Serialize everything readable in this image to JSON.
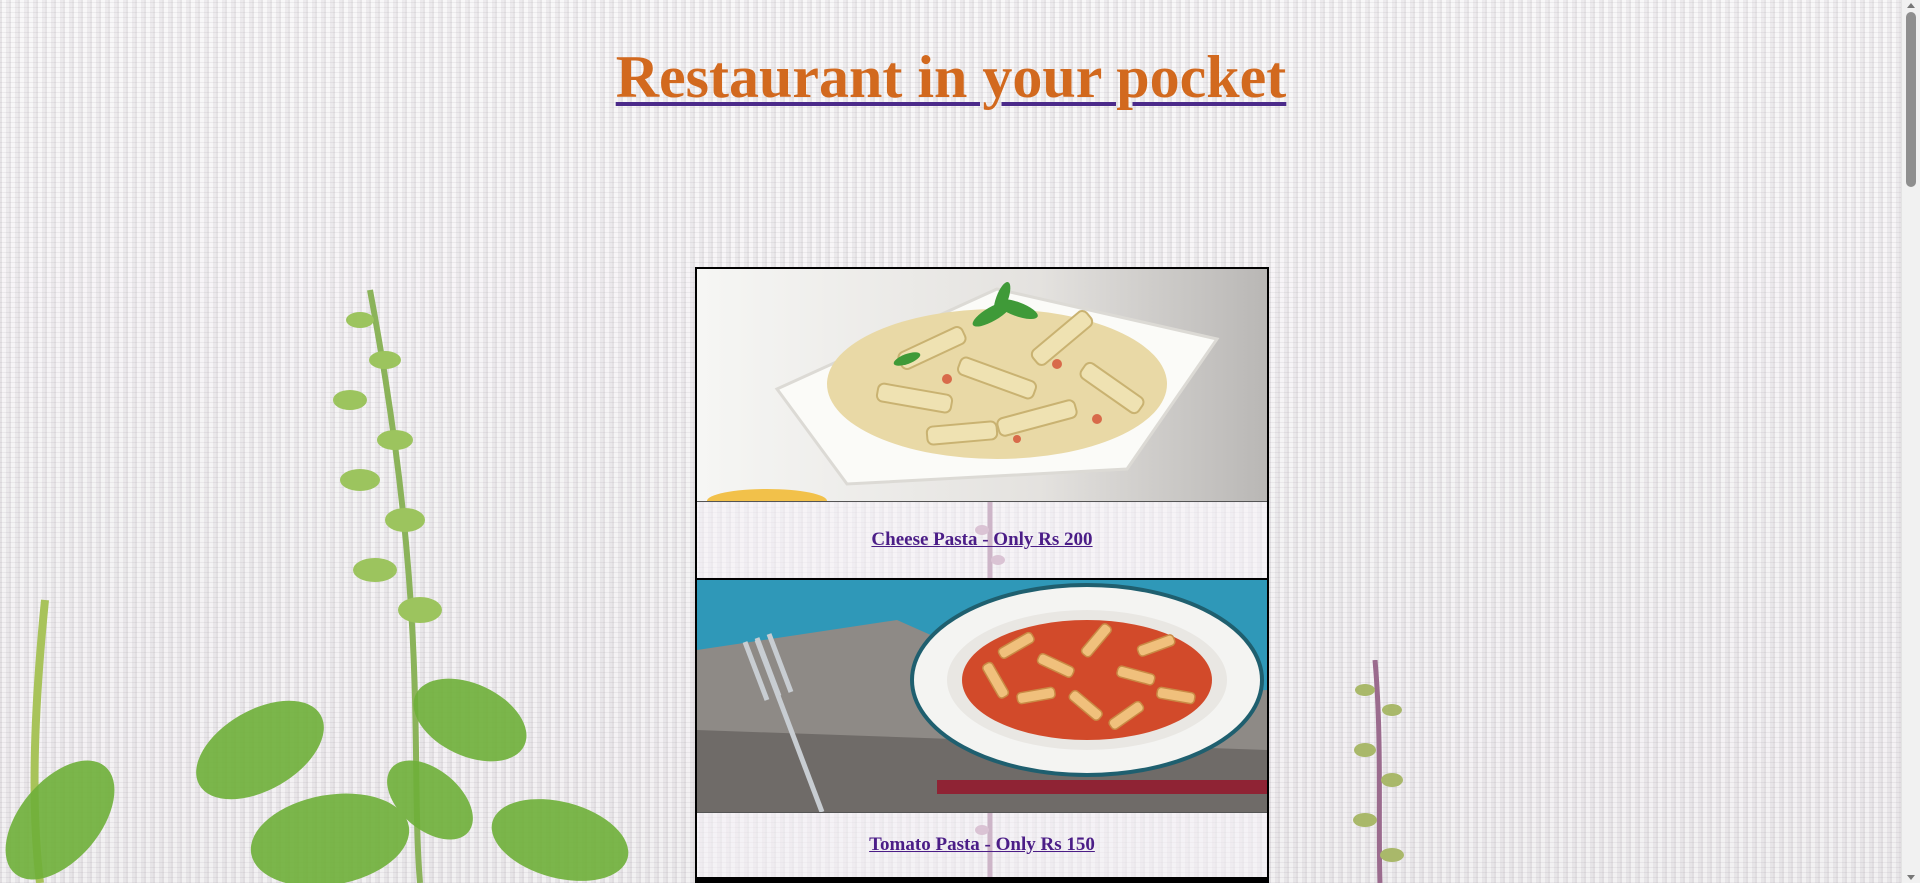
{
  "header": {
    "title": "Restaurant in your pocket"
  },
  "menu": {
    "items": [
      {
        "label": "Cheese Pasta - Only Rs 200",
        "photo": "cheese-pasta-photo"
      },
      {
        "label": "Tomato Pasta - Only Rs 150",
        "photo": "tomato-pasta-photo"
      }
    ]
  },
  "colors": {
    "title": "#d2691e",
    "link": "#4b1d87",
    "background": "#f1eeef"
  }
}
